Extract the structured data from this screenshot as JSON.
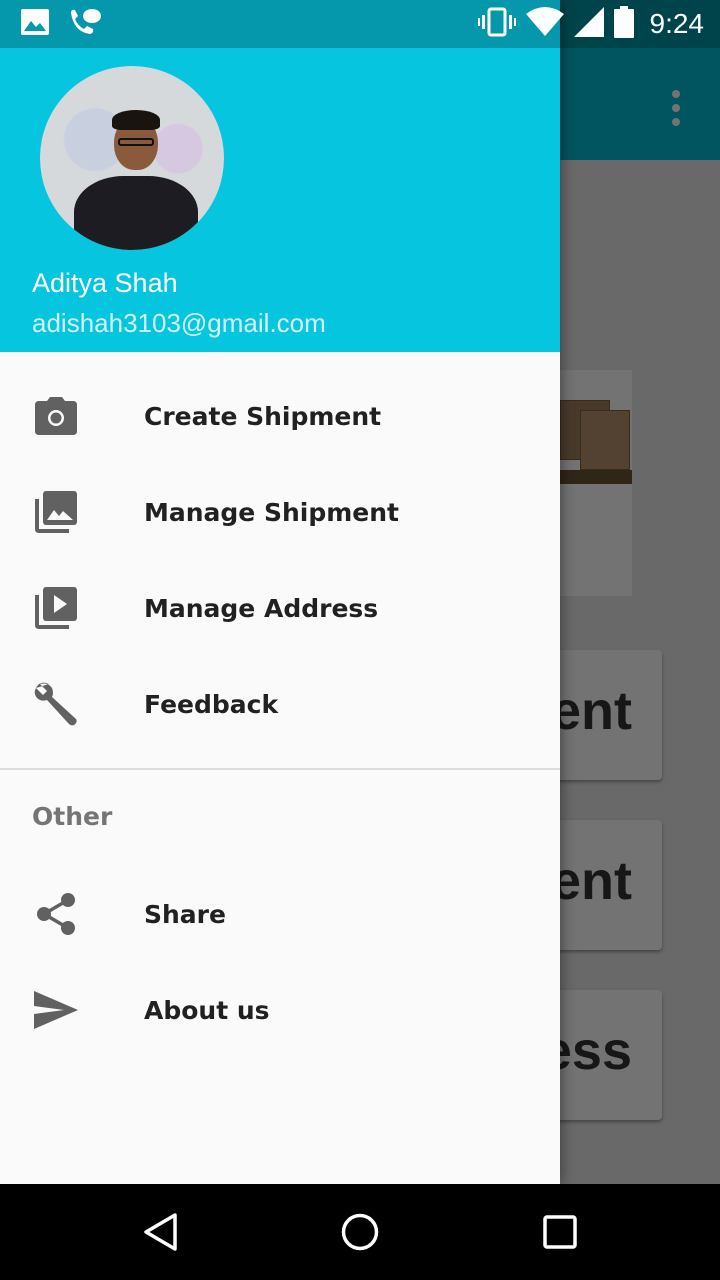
{
  "status_bar": {
    "time": "9:24",
    "icons": [
      "image-notification-icon",
      "voicemail-chat-icon",
      "vibrate-icon",
      "wifi-icon",
      "signal-icon",
      "battery-icon"
    ]
  },
  "background_app": {
    "cards": [
      "ent",
      "nent",
      "ess"
    ]
  },
  "drawer": {
    "header": {
      "user_name": "Aditya Shah",
      "user_email": "adishah3103@gmail.com"
    },
    "items": [
      {
        "label": "Create Shipment",
        "icon": "camera-icon"
      },
      {
        "label": "Manage Shipment",
        "icon": "photo-library-icon"
      },
      {
        "label": "Manage Address",
        "icon": "video-library-icon"
      },
      {
        "label": "Feedback",
        "icon": "wrench-icon"
      }
    ],
    "section_title": "Other",
    "other_items": [
      {
        "label": "Share",
        "icon": "share-icon"
      },
      {
        "label": "About us",
        "icon": "send-icon"
      }
    ]
  },
  "colors": {
    "header": "#06c5df",
    "status_bar": "#0598ad",
    "icon": "#616161",
    "text": "#212121"
  },
  "nav_bar": {
    "buttons": [
      "back-icon",
      "home-icon",
      "recents-icon"
    ]
  }
}
